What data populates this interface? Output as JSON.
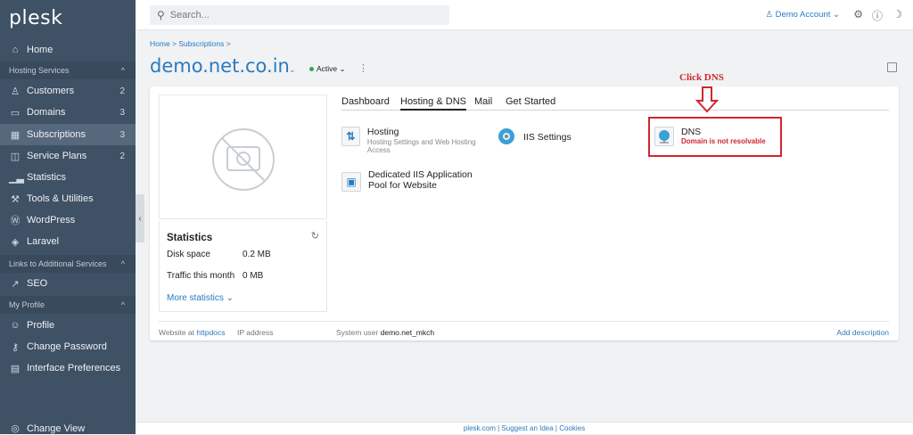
{
  "sidebar": {
    "logo": "plesk",
    "home": "Home",
    "sec_hosting": "Hosting Services",
    "customers": "Customers",
    "customers_count": "2",
    "domains": "Domains",
    "domains_count": "3",
    "subscriptions": "Subscriptions",
    "subscriptions_count": "3",
    "service_plans": "Service Plans",
    "service_plans_count": "2",
    "statistics": "Statistics",
    "tools": "Tools & Utilities",
    "wordpress": "WordPress",
    "laravel": "Laravel",
    "sec_links": "Links to Additional Services",
    "seo": "SEO",
    "sec_profile": "My Profile",
    "profile": "Profile",
    "change_password": "Change Password",
    "interface_prefs": "Interface Preferences",
    "change_view": "Change View"
  },
  "topbar": {
    "search_placeholder": "Search...",
    "account": "Demo Account"
  },
  "breadcrumb": "Home > Subscriptions >",
  "domain": {
    "name": "demo.net.co.in",
    "status": "Active",
    "status_color": "#3aa35a"
  },
  "stats": {
    "title": "Statistics",
    "disk_label": "Disk space",
    "disk_value": "0.2 MB",
    "traffic_label": "Traffic this month",
    "traffic_value": "0 MB",
    "more": "More statistics"
  },
  "tabs": [
    "Dashboard",
    "Hosting & DNS",
    "Mail",
    "Get Started"
  ],
  "tools": {
    "hosting_title": "Hosting",
    "hosting_sub": "Hosting Settings and Web Hosting Access",
    "iis": "IIS Settings",
    "dns_title": "DNS",
    "dns_error": "Domain is not resolvable",
    "pool": "Dedicated IIS Application Pool for Website"
  },
  "annotation": "Click DNS",
  "footer": {
    "website_at": "Website at",
    "httpdocs": "httpdocs",
    "ip": "IP address",
    "sysuser_label": "System user",
    "sysuser": "demo.net_mkch",
    "add_desc": "Add description"
  },
  "bottom": "plesk.com | Suggest an Idea | Cookies",
  "colors": {
    "sidebar": "#3f5164",
    "link": "#2a7bbf",
    "annotation": "#d0262d"
  }
}
